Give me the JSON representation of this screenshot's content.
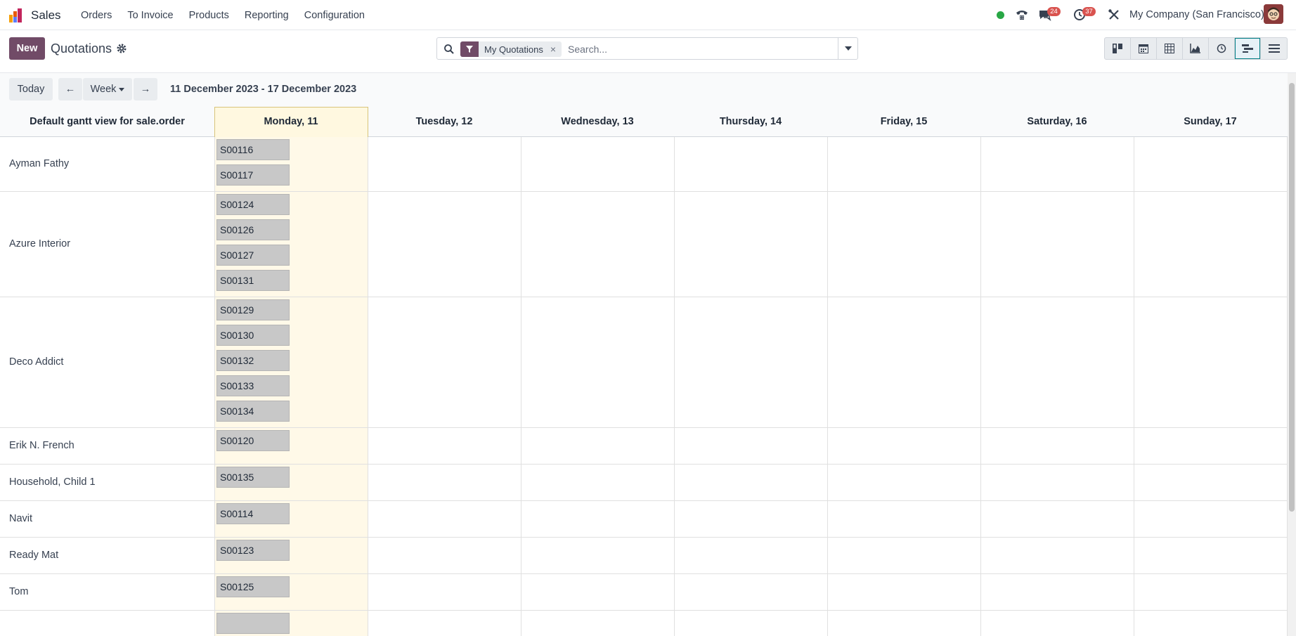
{
  "app": {
    "name": "Sales",
    "menu": [
      "Orders",
      "To Invoice",
      "Products",
      "Reporting",
      "Configuration"
    ]
  },
  "systray": {
    "status_color": "#28a745",
    "discuss_badge": "24",
    "activity_badge": "37",
    "company": "My Company (San Francisco)"
  },
  "control": {
    "new_label": "New",
    "title": "Quotations",
    "search": {
      "facet": "My Quotations",
      "facet_close": "×",
      "placeholder": "Search..."
    },
    "views": [
      "kanban",
      "calendar",
      "pivot",
      "graph",
      "activity",
      "gantt",
      "list"
    ],
    "active_view": "gantt"
  },
  "gantt": {
    "today_label": "Today",
    "prev_label": "←",
    "next_label": "→",
    "scale_label": "Week",
    "date_range": "11 December 2023 - 17 December 2023",
    "header_title": "Default gantt view for sale.order",
    "days": [
      "Monday, 11",
      "Tuesday, 12",
      "Wednesday, 13",
      "Thursday, 14",
      "Friday, 15",
      "Saturday, 16",
      "Sunday, 17"
    ],
    "rows": [
      {
        "name": "Ayman Fathy",
        "records": [
          "S00116",
          "S00117"
        ]
      },
      {
        "name": "Azure Interior",
        "records": [
          "S00124",
          "S00126",
          "S00127",
          "S00131"
        ]
      },
      {
        "name": "Deco Addict",
        "records": [
          "S00129",
          "S00130",
          "S00132",
          "S00133",
          "S00134"
        ]
      },
      {
        "name": "Erik N. French",
        "records": [
          "S00120"
        ]
      },
      {
        "name": "Household, Child 1",
        "records": [
          "S00135"
        ]
      },
      {
        "name": "Navit",
        "records": [
          "S00114"
        ]
      },
      {
        "name": "Ready Mat",
        "records": [
          "S00123"
        ]
      },
      {
        "name": "Tom",
        "records": [
          "S00125"
        ]
      }
    ]
  },
  "colors": {
    "brand": "#714b67",
    "today_column": "#fff9e8",
    "pill": "#c8c8c8"
  }
}
